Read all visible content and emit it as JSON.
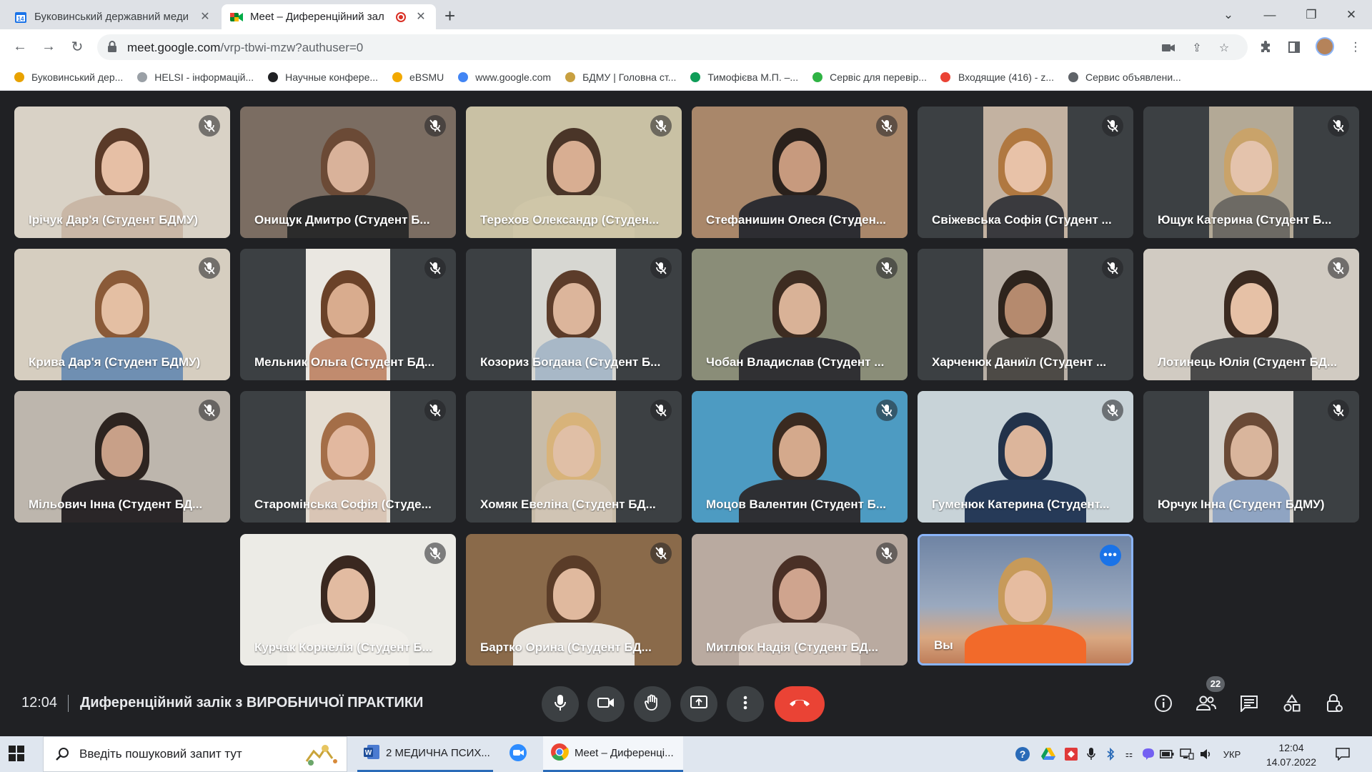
{
  "browser": {
    "tabs": [
      {
        "title": "Буковинський державний меди",
        "favicon": "calendar-icon",
        "active": false
      },
      {
        "title": "Meet – Диференційний зал",
        "favicon": "google-meet-icon",
        "active": true,
        "recording": true
      }
    ],
    "url_host": "meet.google.com",
    "url_rest": "/vrp-tbwi-mzw?authuser=0",
    "bookmarks": [
      {
        "label": "Буковинський дер...",
        "icon": "bdmu-logo-icon",
        "color": "#e8a200"
      },
      {
        "label": "HELSI - інформацій...",
        "icon": "cloud-icon",
        "color": "#9aa0a6"
      },
      {
        "label": "Научные конфере...",
        "icon": "pkp-icon",
        "color": "#202124"
      },
      {
        "label": "eBSMU",
        "icon": "ebsmu-icon",
        "color": "#f2a900"
      },
      {
        "label": "www.google.com",
        "icon": "google-icon",
        "color": "#4285f4"
      },
      {
        "label": "БДМУ | Головна ст...",
        "icon": "bdmu-crest-icon",
        "color": "#c8a040"
      },
      {
        "label": "Тимофієва М.П. –...",
        "icon": "google-drive-icon",
        "color": "#0f9d58"
      },
      {
        "label": "Сервіс для перевір...",
        "icon": "plagiarism-icon",
        "color": "#2fb344"
      },
      {
        "label": "Входящие (416) - z...",
        "icon": "gmail-icon",
        "color": "#ea4335"
      },
      {
        "label": "Сервис объявлени...",
        "icon": "globe-icon",
        "color": "#5f6368"
      }
    ]
  },
  "participants": [
    {
      "name": "Ірічук Дар'я (Студент БДМУ)",
      "bg": "#d9d2c6",
      "skin": "#e6bfa5",
      "hair": "#5a3a28",
      "shirt": "#c9b7a6",
      "layout": "full"
    },
    {
      "name": "Онищук Дмитро (Студент Б...",
      "bg": "#7b6d62",
      "skin": "#d9b29a",
      "hair": "#6b4a36",
      "shirt": "#2b2b2b",
      "layout": "full"
    },
    {
      "name": "Терехов Олександр (Студен...",
      "bg": "#c9c1a4",
      "skin": "#d8ae92",
      "hair": "#4a3528",
      "shirt": "#cfc6a8",
      "layout": "full"
    },
    {
      "name": "Стефанишин Олеся (Студен...",
      "bg": "#a9876a",
      "skin": "#c79a7e",
      "hair": "#2a211c",
      "shirt": "#2d2d32",
      "layout": "full"
    },
    {
      "name": "Свіжевська Софія (Студент ...",
      "bg": "#c3b2a1",
      "skin": "#e8c2a8",
      "hair": "#b07840",
      "shirt": "#3a3a3e",
      "layout": "narrow"
    },
    {
      "name": "Ющук Катерина (Студент Б...",
      "bg": "#b3a996",
      "skin": "#e4c3ac",
      "hair": "#c9a36a",
      "shirt": "#6d6a64",
      "layout": "narrow"
    },
    {
      "name": "Крива Дар'я (Студент БДМУ)",
      "bg": "#d6cec0",
      "skin": "#e4bfa3",
      "hair": "#8a5a38",
      "shirt": "#6f8fb2",
      "layout": "full"
    },
    {
      "name": "Мельник Ольга (Студент БД...",
      "bg": "#eae7e1",
      "skin": "#d9ac8e",
      "hair": "#6a4128",
      "shirt": "#c18b6e",
      "layout": "narrow"
    },
    {
      "name": "Козориз Богдана (Студент Б...",
      "bg": "#d7d7d2",
      "skin": "#dcb59b",
      "hair": "#5c3c2a",
      "shirt": "#a8b8c7",
      "layout": "narrow"
    },
    {
      "name": "Чобан Владислав (Студент ...",
      "bg": "#8a8d78",
      "skin": "#d9b297",
      "hair": "#3d2c21",
      "shirt": "#303033",
      "layout": "full"
    },
    {
      "name": "Харченюк Даниїл (Студент ...",
      "bg": "#b9b0a6",
      "skin": "#b58a6e",
      "hair": "#2e241d",
      "shirt": "#4d4a46",
      "layout": "narrow"
    },
    {
      "name": "Лотинець Юлія (Студент БД...",
      "bg": "#d1cbc2",
      "skin": "#e6c1a6",
      "hair": "#3b2a20",
      "shirt": "#4a4a4a",
      "layout": "full"
    },
    {
      "name": "Мільович Інна (Студент БД...",
      "bg": "#bdb6ad",
      "skin": "#c8a088",
      "hair": "#2d2420",
      "shirt": "#2a2628",
      "layout": "full"
    },
    {
      "name": "Старомінська Софія (Студе...",
      "bg": "#e4ddd2",
      "skin": "#e2b89f",
      "hair": "#a46e48",
      "shirt": "#d9c5b5",
      "layout": "narrow"
    },
    {
      "name": "Хомяк Евеліна (Студент БД...",
      "bg": "#c8bca9",
      "skin": "#e0bfa6",
      "hair": "#d8b37a",
      "shirt": "#d0c4b4",
      "layout": "narrow"
    },
    {
      "name": "Моцов Валентин (Студент Б...",
      "bg": "#4d9bc2",
      "skin": "#d4a98c",
      "hair": "#3a2a20",
      "shirt": "#2e2f33",
      "layout": "full"
    },
    {
      "name": "Гуменюк Катерина (Студент...",
      "bg": "#c8d3d8",
      "skin": "#dcb59b",
      "hair": "#22324a",
      "shirt": "#263a58",
      "layout": "full"
    },
    {
      "name": "Юрчук Інна (Студент БДМУ)",
      "bg": "#d5d2cc",
      "skin": "#d9b59c",
      "hair": "#6a4a36",
      "shirt": "#8fa4c2",
      "layout": "narrow"
    },
    {
      "name": "Курчак Корнелія (Студент Б...",
      "bg": "#ecebe6",
      "skin": "#e2bba1",
      "hair": "#3a2820",
      "shirt": "#f0eee9",
      "layout": "full"
    },
    {
      "name": "Бартко Орина (Студент БД...",
      "bg": "#8a6a4a",
      "skin": "#e0b99e",
      "hair": "#5a3c28",
      "shirt": "#e8e4de",
      "layout": "full"
    },
    {
      "name": "Митлюк Надія (Студент БД...",
      "bg": "#b9aaa0",
      "skin": "#cfa48e",
      "hair": "#4a3026",
      "shirt": "#d2c4ba",
      "layout": "full"
    },
    {
      "name": "Вы",
      "bg": "#7d8ea6",
      "skin": "#e6bca0",
      "hair": "#c79a5a",
      "shirt": "#f26a2a",
      "layout": "self"
    }
  ],
  "meeting": {
    "time": "12:04",
    "title": "Диференційний залік з ВИРОБНИЧОЇ ПРАКТИКИ",
    "participant_count": "22",
    "controls": [
      "mic-off-icon",
      "camera-icon",
      "raise-hand-icon",
      "present-screen-icon",
      "more-options-icon",
      "end-call-icon"
    ],
    "right_controls": [
      "meeting-info-icon",
      "people-icon",
      "chat-icon",
      "activities-icon",
      "host-controls-icon"
    ]
  },
  "taskbar": {
    "search_placeholder": "Введіть пошуковий запит тут",
    "apps": [
      {
        "label": "2 МЕДИЧНА ПСИХ...",
        "icon": "word-icon"
      },
      {
        "label": "",
        "icon": "zoom-icon"
      },
      {
        "label": "Meet – Диференці...",
        "icon": "chrome-icon"
      }
    ],
    "lang": "УКР",
    "time": "12:04",
    "date": "14.07.2022"
  }
}
